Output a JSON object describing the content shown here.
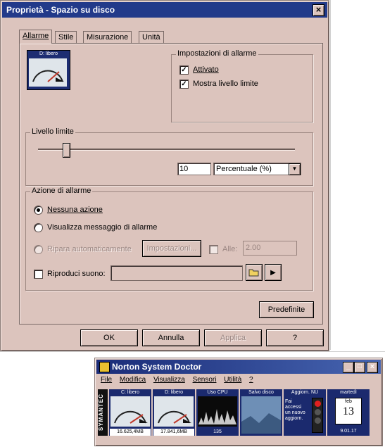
{
  "dialog": {
    "title": "Proprietà - Spazio su disco",
    "close_glyph": "×",
    "tabs": [
      {
        "label": "Allarme",
        "active": true
      },
      {
        "label": "Stile"
      },
      {
        "label": "Misurazione"
      },
      {
        "label": "Unità"
      }
    ],
    "preview_label": "D: libero",
    "alarm_settings": {
      "label": "Impostazioni di allarme",
      "activated": {
        "label": "Attivato",
        "checked": true
      },
      "show_limit": {
        "label": "Mostra livello limite",
        "checked": true
      }
    },
    "limit_level": {
      "label": "Livello limite",
      "value": "10",
      "unit": "Percentuale (%)",
      "slider_position": 0.1
    },
    "alarm_action": {
      "label": "Azione di allarme",
      "options": [
        {
          "label": "Nessuna azione",
          "selected": true
        },
        {
          "label": "Visualizza messaggio di allarme",
          "selected": false
        }
      ],
      "auto_repair": {
        "label": "Ripara automaticamente",
        "settings_button": "Impostazioni...",
        "at_label": "Alle:",
        "time": "2.00"
      },
      "play_sound": {
        "label": "Riproduci suono:",
        "value": ""
      }
    },
    "defaults_button": "Predefinite",
    "buttons": {
      "ok": "OK",
      "cancel": "Annulla",
      "apply": "Applica",
      "help": "?"
    }
  },
  "nsd": {
    "title": "Norton System Doctor",
    "menu": [
      "File",
      "Modifica",
      "Visualizza",
      "Sensori",
      "Utilità",
      "?"
    ],
    "brand": "SYMANTEC",
    "panels": [
      {
        "title": "C: libero",
        "value": "16.625,4MB"
      },
      {
        "title": "D: libero",
        "value": "17.841,6MB"
      },
      {
        "title": "Uso CPU",
        "value": "135"
      },
      {
        "title": "Salvo disco",
        "value": ""
      },
      {
        "title": "Aggiorn. NU",
        "text": [
          "Fai",
          "accessi",
          "un nuovo",
          "aggiorn."
        ]
      },
      {
        "title": "martedì",
        "month": "feb",
        "day": "13",
        "date": "9.01.17"
      }
    ],
    "controls": [
      "_",
      "□",
      "×"
    ]
  }
}
